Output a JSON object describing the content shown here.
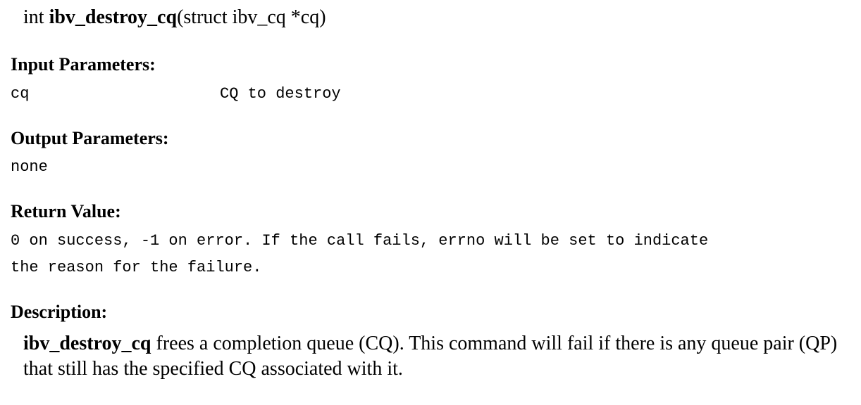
{
  "signature": {
    "return_type": "int",
    "function_name": "ibv_destroy_cq",
    "params": "(struct ibv_cq *cq)"
  },
  "input_parameters": {
    "heading": "Input Parameters:",
    "rows": [
      {
        "name": "cq",
        "description": "CQ to destroy"
      }
    ]
  },
  "output_parameters": {
    "heading": "Output Parameters:",
    "text": "none"
  },
  "return_value": {
    "heading": "Return Value:",
    "line1": "0 on success, -1 on error. If the call fails, errno will be set to indicate",
    "line2": "the reason for the failure."
  },
  "description": {
    "heading": "Description:",
    "function_name": "ibv_destroy_cq",
    "text": "frees a completion queue (CQ). This command will fail if there is any queue pair (QP) that still has the specified CQ associated with it."
  }
}
